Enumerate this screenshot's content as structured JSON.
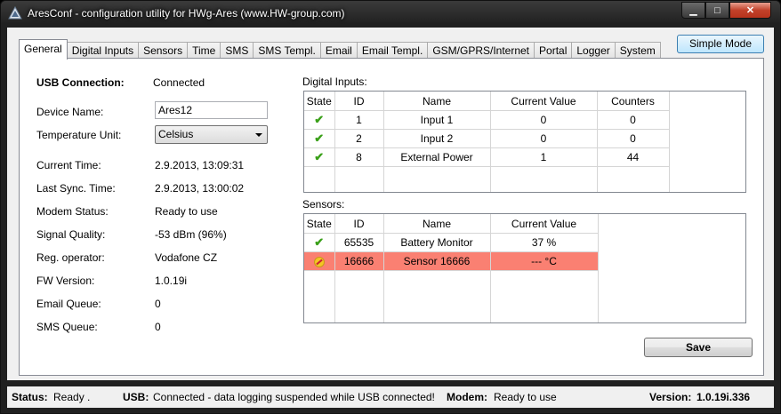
{
  "window": {
    "title": "AresConf - configuration utility for HWg-Ares (www.HW-group.com)"
  },
  "tabs": [
    "General",
    "Digital Inputs",
    "Sensors",
    "Time",
    "SMS",
    "SMS Templ.",
    "Email",
    "Email Templ.",
    "GSM/GPRS/Internet",
    "Portal",
    "Logger",
    "System"
  ],
  "active_tab": "General",
  "simple_mode_label": "Simple Mode",
  "general": {
    "usb_label": "USB Connection:",
    "usb_value": "Connected",
    "device_name_label": "Device Name:",
    "device_name_value": "Ares12",
    "temp_unit_label": "Temperature Unit:",
    "temp_unit_value": "Celsius",
    "current_time_label": "Current Time:",
    "current_time_value": "2.9.2013, 13:09:31",
    "last_sync_label": "Last Sync. Time:",
    "last_sync_value": "2.9.2013, 13:00:02",
    "modem_status_label": "Modem Status:",
    "modem_status_value": "Ready to use",
    "signal_label": "Signal Quality:",
    "signal_value": "-53 dBm (96%)",
    "operator_label": "Reg. operator:",
    "operator_value": "Vodafone CZ",
    "fw_label": "FW Version:",
    "fw_value": "1.0.19i",
    "email_queue_label": "Email Queue:",
    "email_queue_value": "0",
    "sms_queue_label": "SMS Queue:",
    "sms_queue_value": "0"
  },
  "digital_inputs": {
    "title": "Digital Inputs:",
    "columns": [
      "State",
      "ID",
      "Name",
      "Current Value",
      "Counters"
    ],
    "rows": [
      {
        "state": "ok",
        "id": "1",
        "name": "Input 1",
        "value": "0",
        "counters": "0"
      },
      {
        "state": "ok",
        "id": "2",
        "name": "Input 2",
        "value": "0",
        "counters": "0"
      },
      {
        "state": "ok",
        "id": "8",
        "name": "External Power",
        "value": "1",
        "counters": "44"
      }
    ]
  },
  "sensors": {
    "title": "Sensors:",
    "columns": [
      "State",
      "ID",
      "Name",
      "Current Value"
    ],
    "rows": [
      {
        "state": "ok",
        "id": "65535",
        "name": "Battery Monitor",
        "value": "37 %"
      },
      {
        "state": "error",
        "id": "16666",
        "name": "Sensor 16666",
        "value": "--- °C"
      }
    ],
    "alert_color": "#fa8072"
  },
  "save_label": "Save",
  "statusbar": {
    "status_label": "Status:",
    "status_value": "Ready .",
    "usb_label": "USB:",
    "usb_value": "Connected - data logging suspended while USB connected!",
    "modem_label": "Modem:",
    "modem_value": "Ready to use",
    "version_label": "Version:",
    "version_value": "1.0.19i.336"
  }
}
